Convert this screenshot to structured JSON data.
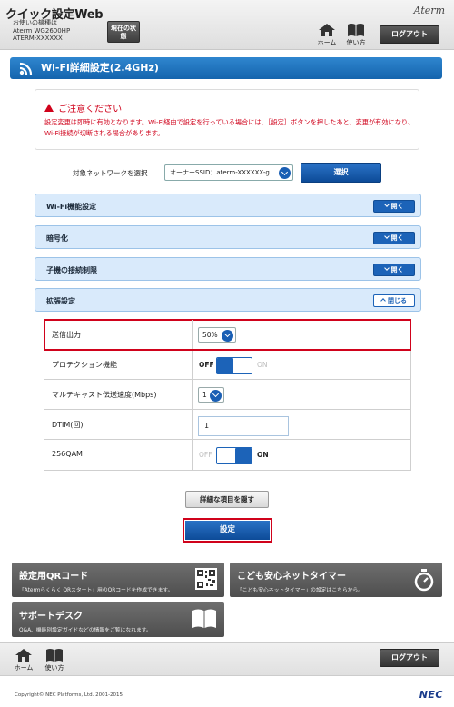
{
  "header": {
    "app_title": "クイック設定Web",
    "model_label": "お使いの機種は",
    "model_name": "Aterm WG2600HP",
    "model_id": "ATERM-XXXXXX",
    "status_button": "現在の状態",
    "logo": "Aterm",
    "nav_home": "ホーム",
    "nav_guide": "使い方",
    "logout": "ログアウト"
  },
  "section_title": "Wi-Fi詳細設定(2.4GHz)",
  "caution": {
    "title": "ご注意ください",
    "text": "設定変更は即時に有効となります。Wi-Fi経由で設定を行っている場合には、［設定］ボタンを押したあと、変更が有効になり、Wi-Fi接続が切断される場合があります。"
  },
  "network_select": {
    "label": "対象ネットワークを選択",
    "value": "オーナーSSID：aterm-XXXXXX-g",
    "button": "選択"
  },
  "accordions": [
    {
      "label": "Wi-Fi機能設定",
      "button": "開く",
      "state": "closed"
    },
    {
      "label": "暗号化",
      "button": "開く",
      "state": "closed"
    },
    {
      "label": "子機の接続制限",
      "button": "開く",
      "state": "closed"
    },
    {
      "label": "拡張設定",
      "button": "閉じる",
      "state": "open"
    }
  ],
  "settings": {
    "tx_power": {
      "label": "送信出力",
      "value": "50%"
    },
    "protection": {
      "label": "プロテクション機能",
      "off": "OFF",
      "on": "ON",
      "state": "off"
    },
    "multicast": {
      "label": "マルチキャスト伝送速度(Mbps)",
      "value": "1"
    },
    "dtim": {
      "label": "DTIM(回)",
      "value": "1"
    },
    "qam256": {
      "label": "256QAM",
      "off": "OFF",
      "on": "ON",
      "state": "on"
    }
  },
  "buttons": {
    "hide_detail": "詳細な項目を隠す",
    "apply": "設定"
  },
  "panels": {
    "qr": {
      "title": "設定用QRコード",
      "desc": "「Atermらくらく QRスタート」用のQRコードを作成できます。"
    },
    "timer": {
      "title": "こども安心ネットタイマー",
      "desc": "「こども安心ネットタイマー」の設定はこちらから。"
    },
    "support": {
      "title": "サポートデスク",
      "desc": "Q&A、機能別設定ガイドなどの情報をご覧になれます。"
    }
  },
  "footer": {
    "nav_home": "ホーム",
    "nav_guide": "使い方",
    "logout": "ログアウト",
    "copyright": "Copyright© NEC Platforms, Ltd. 2001-2015",
    "logo": "NEC"
  },
  "colors": {
    "primary_blue": "#1464ad",
    "accent_red": "#d0021b",
    "accordion_bg": "#d9eafb"
  }
}
